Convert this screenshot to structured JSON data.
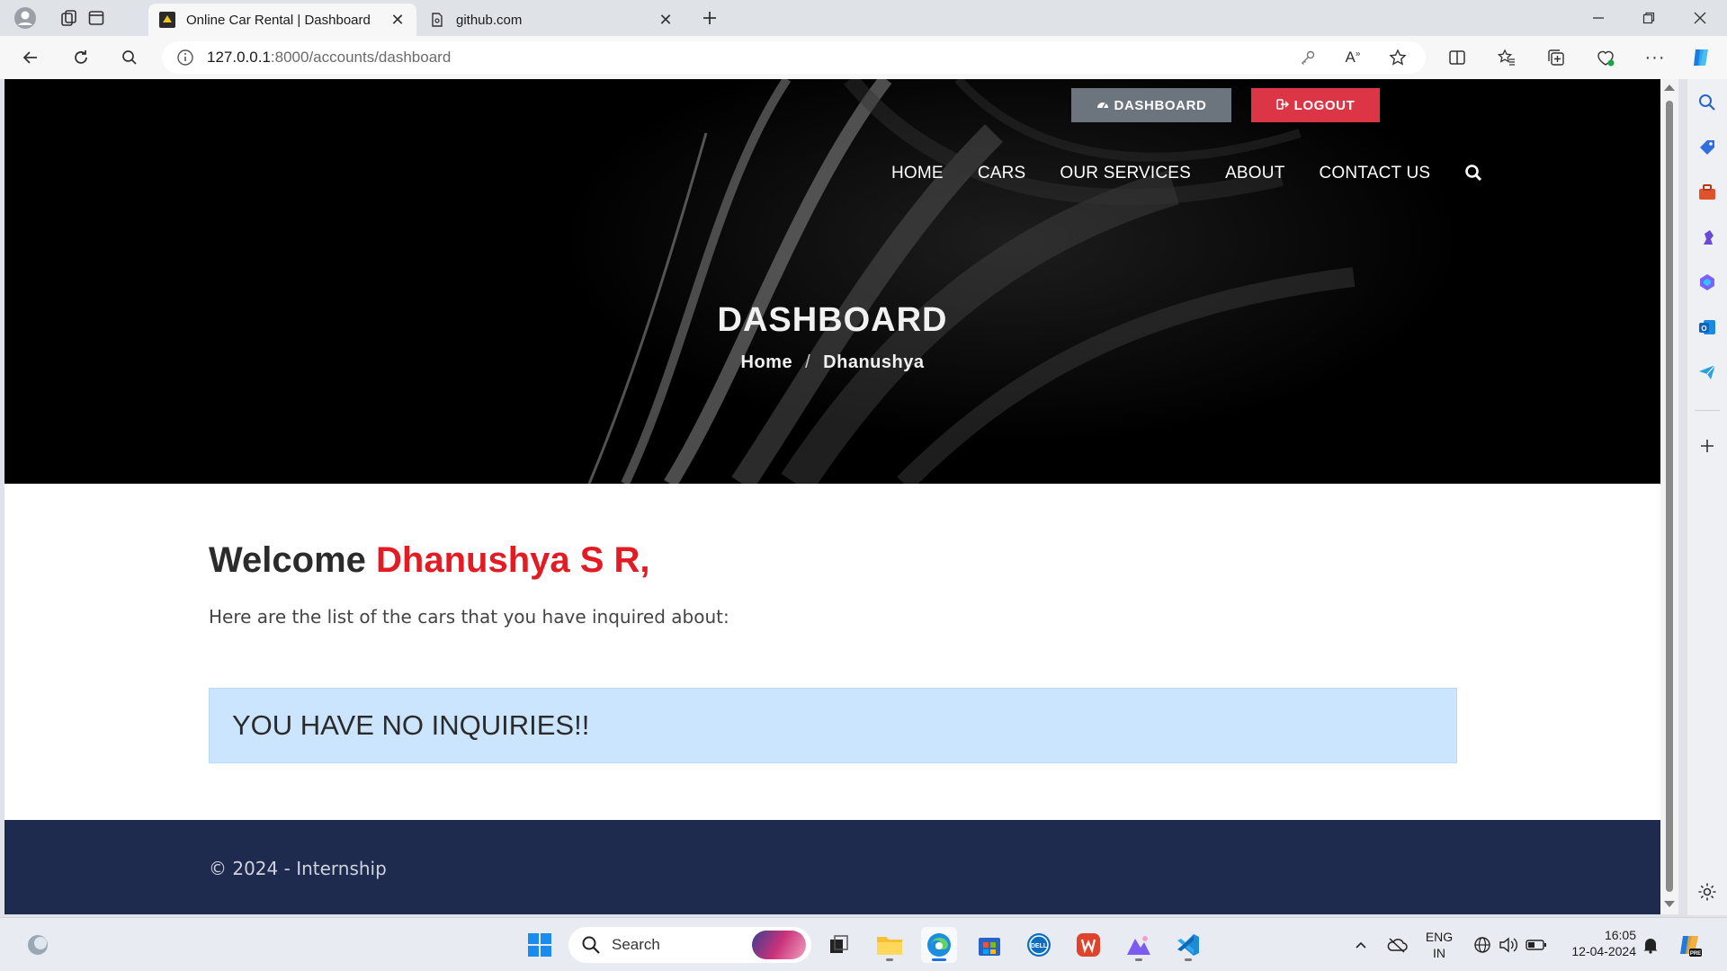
{
  "browser": {
    "tabs": [
      {
        "title": "Online Car Rental | Dashboard",
        "active": true
      },
      {
        "title": "github.com",
        "active": false
      }
    ],
    "url_host": "127.0.0.1",
    "url_path": ":8000/accounts/dashboard"
  },
  "page": {
    "top_buttons": {
      "dashboard": "DASHBOARD",
      "logout": "LOGOUT"
    },
    "menu": [
      "HOME",
      "CARS",
      "OUR SERVICES",
      "ABOUT",
      "CONTACT US"
    ],
    "hero_title": "DASHBOARD",
    "breadcrumb": {
      "home": "Home",
      "separator": "/",
      "current": "Dhanushya"
    },
    "welcome_prefix": "Welcome",
    "welcome_name": "Dhanushya S R,",
    "subtext": "Here are the list of the cars that you have inquired about:",
    "alert": "YOU HAVE NO INQUIRIES!!",
    "footer": "© 2024 - Internship",
    "colors": {
      "accent_red": "#e31b23",
      "footer_bg": "#1f2a4f",
      "alert_bg": "#cce5ff",
      "dashboard_btn": "#6c757d",
      "logout_btn": "#dc3545"
    }
  },
  "taskbar": {
    "search_placeholder": "Search",
    "lang_line1": "ENG",
    "lang_line2": "IN",
    "time": "16:05",
    "date": "12-04-2024"
  }
}
